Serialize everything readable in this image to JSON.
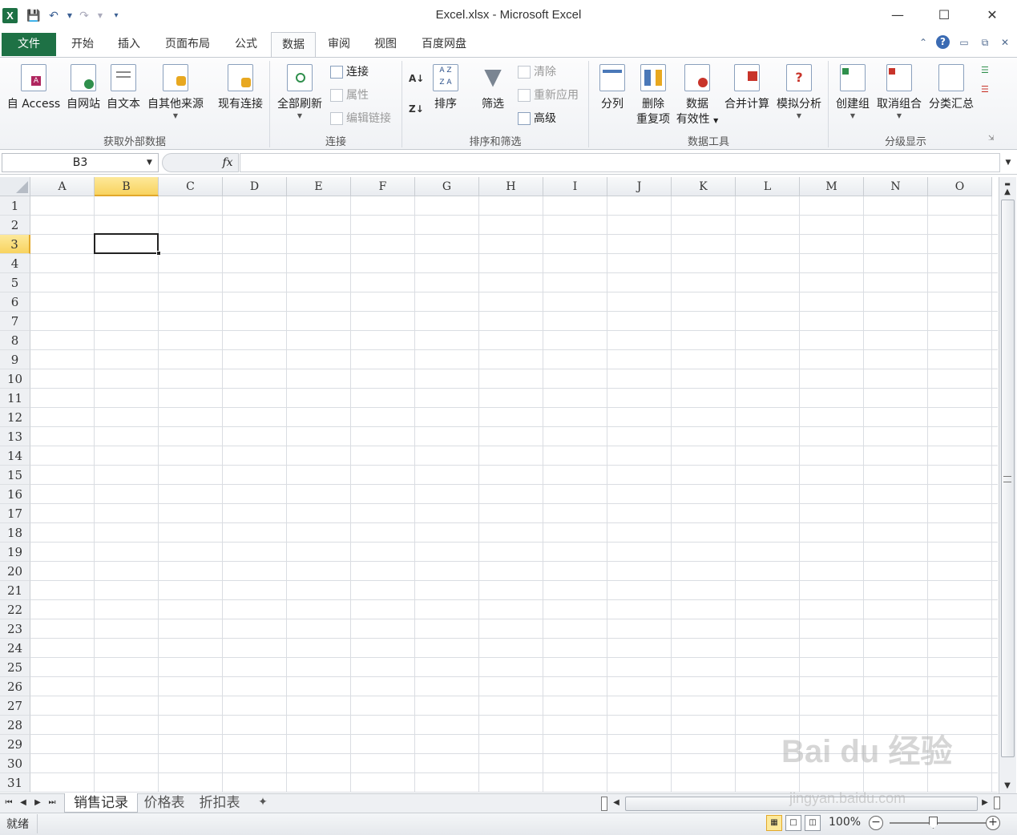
{
  "window": {
    "title": "Excel.xlsx - Microsoft Excel",
    "app_icon": "X"
  },
  "tabs": {
    "file": "文件",
    "items": [
      "开始",
      "插入",
      "页面布局",
      "公式",
      "数据",
      "审阅",
      "视图",
      "百度网盘"
    ],
    "active": "数据"
  },
  "ribbon": {
    "get_external": {
      "label": "获取外部数据",
      "access": "自 Access",
      "web": "自网站",
      "text": "自文本",
      "other": "自其他来源",
      "existing": "现有连接"
    },
    "connections": {
      "label": "连接",
      "refresh_all": "全部刷新",
      "connections": "连接",
      "properties": "属性",
      "edit_links": "编辑链接"
    },
    "sort_filter": {
      "label": "排序和筛选",
      "sort": "排序",
      "filter": "筛选",
      "clear": "清除",
      "reapply": "重新应用",
      "advanced": "高级"
    },
    "data_tools": {
      "label": "数据工具",
      "text_to_columns": "分列",
      "remove_dup_1": "删除",
      "remove_dup_2": "重复项",
      "validation_1": "数据",
      "validation_2": "有效性",
      "consolidate": "合并计算",
      "what_if": "模拟分析"
    },
    "outline": {
      "label": "分级显示",
      "group": "创建组",
      "ungroup": "取消组合",
      "subtotal": "分类汇总"
    }
  },
  "formula_bar": {
    "name_box": "B3",
    "fx": "fx",
    "value": ""
  },
  "grid": {
    "columns": [
      "A",
      "B",
      "C",
      "D",
      "E",
      "F",
      "G",
      "H",
      "I",
      "J",
      "K",
      "L",
      "M",
      "N",
      "O"
    ],
    "rows": [
      "1",
      "2",
      "3",
      "4",
      "5",
      "6",
      "7",
      "8",
      "9",
      "10",
      "11",
      "12",
      "13",
      "14",
      "15",
      "16",
      "17",
      "18",
      "19",
      "20",
      "21",
      "22",
      "23",
      "24",
      "25",
      "26",
      "27",
      "28",
      "29",
      "30",
      "31"
    ],
    "selected_column": "B",
    "selected_row": "3"
  },
  "sheets": {
    "tabs": [
      "销售记录",
      "价格表",
      "折扣表"
    ],
    "active": "销售记录"
  },
  "status": {
    "ready": "就绪",
    "zoom": "100%"
  },
  "watermark": {
    "main": "Bai du 经验",
    "sub": "jingyan.baidu.com"
  },
  "colors": {
    "file_tab": "#1e7145",
    "selection": "#f8d35f",
    "selection_border": "#e2a82b"
  }
}
